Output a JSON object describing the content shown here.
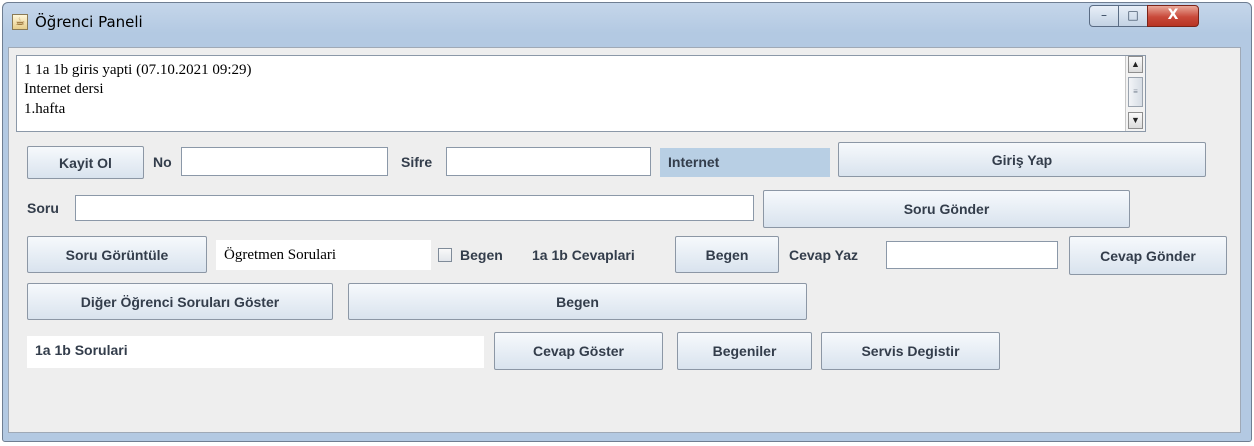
{
  "window": {
    "title": "Öğrenci Paneli",
    "icon": "java-cup-icon",
    "controls": {
      "minimize": "–",
      "maximize": "□",
      "close": "X"
    }
  },
  "log": {
    "lines": [
      "1 1a 1b  giris yapti (07.10.2021 09:29)",
      "Internet dersi",
      "1.hafta"
    ],
    "scroll_up": "▲",
    "scroll_down": "▼",
    "scroll_grip": "≡"
  },
  "login_row": {
    "register_label": "Kayit Ol",
    "no_label": "No",
    "no_value": "",
    "password_label": "Sifre",
    "password_value": "",
    "course_label": "Internet",
    "login_label": "Giriş Yap"
  },
  "question_row": {
    "question_label": "Soru",
    "question_value": "",
    "send_label": "Soru Gönder"
  },
  "answer_row": {
    "view_questions_label": "Soru Görüntüle",
    "teacher_questions_label": "Ögretmen Sorulari",
    "like_check_label": "Begen",
    "like_checked": false,
    "answers_label": "1a 1b Cevaplari",
    "like_button_label": "Begen",
    "write_answer_label": "Cevap Yaz",
    "answer_value": "",
    "send_answer_label": "Cevap Gönder"
  },
  "others_row": {
    "show_others_label": "Diğer Öğrenci Soruları Göster",
    "like_label": "Begen"
  },
  "bottom_row": {
    "my_questions_label": "1a 1b Sorulari",
    "show_answer_label": "Cevap Göster",
    "likes_label": "Begeniler",
    "change_service_label": "Servis Degistir"
  }
}
